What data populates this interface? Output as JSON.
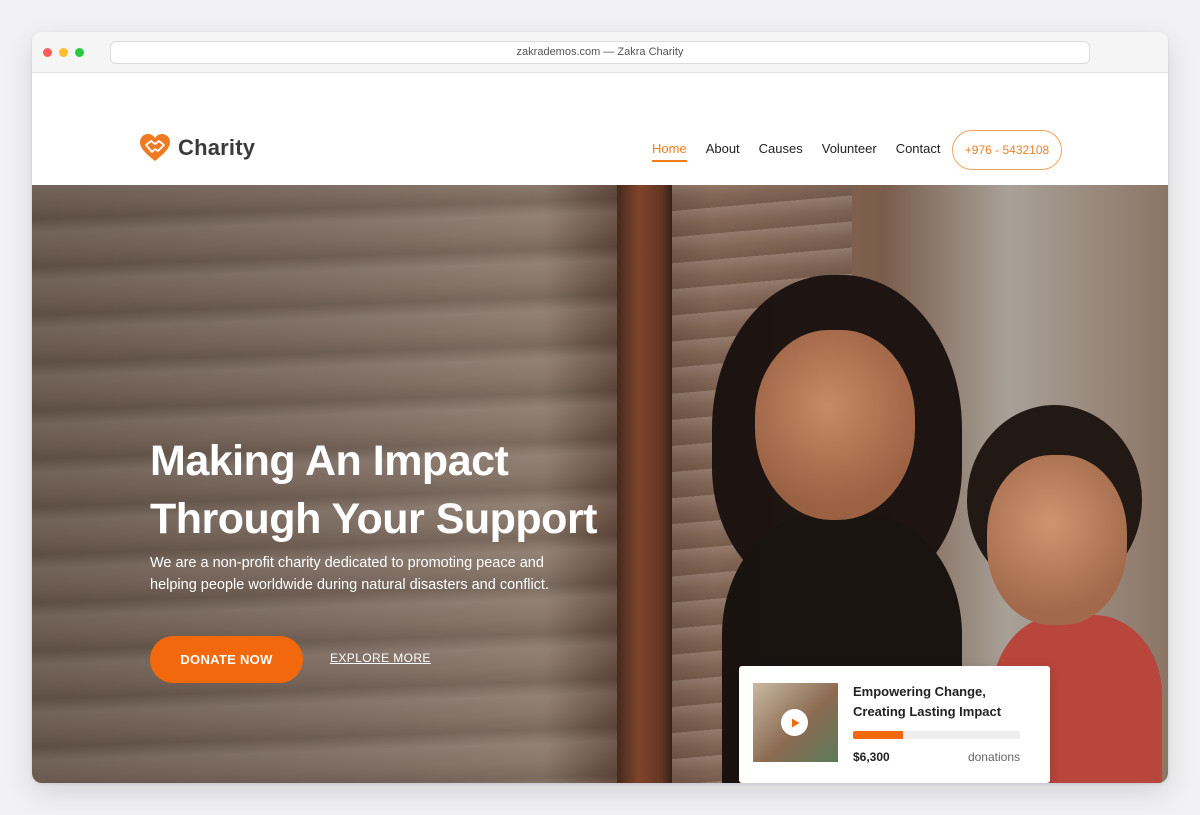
{
  "browser": {
    "url_title": "zakrademos.com — Zakra Charity"
  },
  "site": {
    "logo_text": "Charity"
  },
  "nav": {
    "items": [
      {
        "label": "Home",
        "active": true
      },
      {
        "label": "About",
        "active": false
      },
      {
        "label": "Causes",
        "active": false
      },
      {
        "label": "Volunteer",
        "active": false
      },
      {
        "label": "Contact",
        "active": false
      }
    ],
    "phone": "+976 - 5432108"
  },
  "hero": {
    "title_line1": "Making An Impact",
    "title_line2": "Through Your Support",
    "subtitle_line1": "We are a non-profit charity dedicated to promoting peace and",
    "subtitle_line2": "helping people worldwide during natural disasters and conflict.",
    "donate_label": "DONATE NOW",
    "explore_label": "EXPLORE MORE"
  },
  "campaign": {
    "title_line1": "Empowering Change,",
    "title_line2": "Creating Lasting Impact",
    "progress": 0.3,
    "amount": "$6,300",
    "amount_label": "donations"
  },
  "colors": {
    "accent": "#f2690d",
    "nav_active": "#f07e1e"
  },
  "icons": [
    "heart-handshake-icon",
    "play-icon"
  ]
}
